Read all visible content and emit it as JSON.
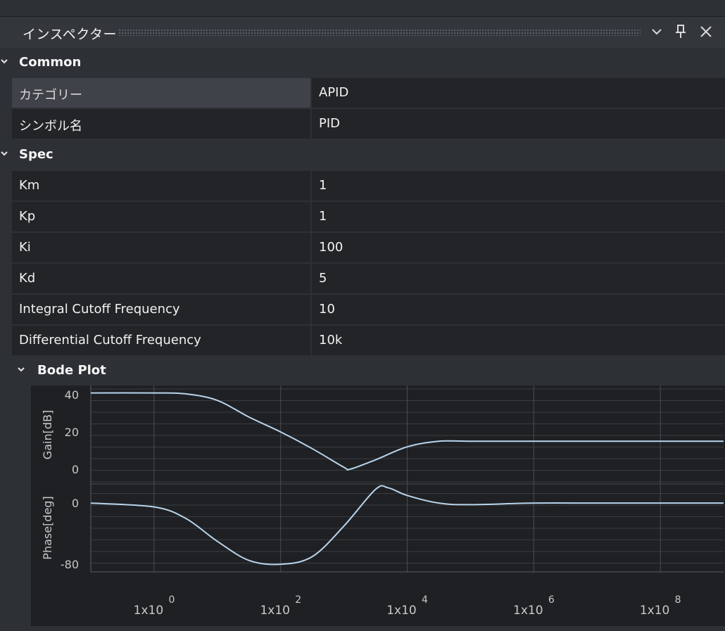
{
  "panel": {
    "title": "インスペクター",
    "icons": [
      "chevron-down-icon",
      "pin-icon",
      "close-icon"
    ]
  },
  "sections": {
    "common": "Common",
    "spec": "Spec",
    "bode": "Bode Plot"
  },
  "common_rows": [
    {
      "key": "カテゴリー",
      "value": "APID"
    },
    {
      "key": "シンボル名",
      "value": "PID"
    }
  ],
  "spec_rows": [
    {
      "key": "Km",
      "value": "1"
    },
    {
      "key": "Kp",
      "value": "1"
    },
    {
      "key": "Ki",
      "value": "100"
    },
    {
      "key": "Kd",
      "value": "5"
    },
    {
      "key": "Integral Cutoff Frequency",
      "value": "10"
    },
    {
      "key": "Differential Cutoff Frequency",
      "value": "10k"
    }
  ],
  "chart_data": {
    "type": "line",
    "xscale": "log",
    "xlim": [
      -1,
      9
    ],
    "x_ticks": [
      {
        "base": "1x10",
        "exp": "0"
      },
      {
        "base": "1x10",
        "exp": "2"
      },
      {
        "base": "1x10",
        "exp": "4"
      },
      {
        "base": "1x10",
        "exp": "6"
      },
      {
        "base": "1x10",
        "exp": "8"
      }
    ],
    "panels": [
      {
        "ylabel": "Gain[dB]",
        "ylim": [
          -8,
          45
        ],
        "yticks": [
          "40",
          "20",
          "0"
        ],
        "x": [
          -1,
          0,
          0.5,
          1,
          1.5,
          2,
          2.5,
          3,
          3.1,
          3.5,
          4,
          4.5,
          5,
          6,
          7,
          8,
          9
        ],
        "y": [
          41,
          41,
          40.5,
          37,
          28,
          20,
          11,
          1,
          0,
          5,
          12,
          15,
          15,
          15,
          15,
          15,
          15
        ]
      },
      {
        "ylabel": "Phase[deg]",
        "ylim": [
          -90,
          25
        ],
        "yticks": [
          "0",
          "-80"
        ],
        "x": [
          -1,
          0,
          0.5,
          1,
          1.5,
          2,
          2.5,
          3,
          3.5,
          3.7,
          4,
          4.5,
          5,
          6,
          7,
          8,
          9
        ],
        "y": [
          0,
          -5,
          -20,
          -50,
          -75,
          -80,
          -70,
          -30,
          18,
          20,
          10,
          0,
          -2,
          0,
          0,
          0,
          0
        ]
      }
    ]
  }
}
